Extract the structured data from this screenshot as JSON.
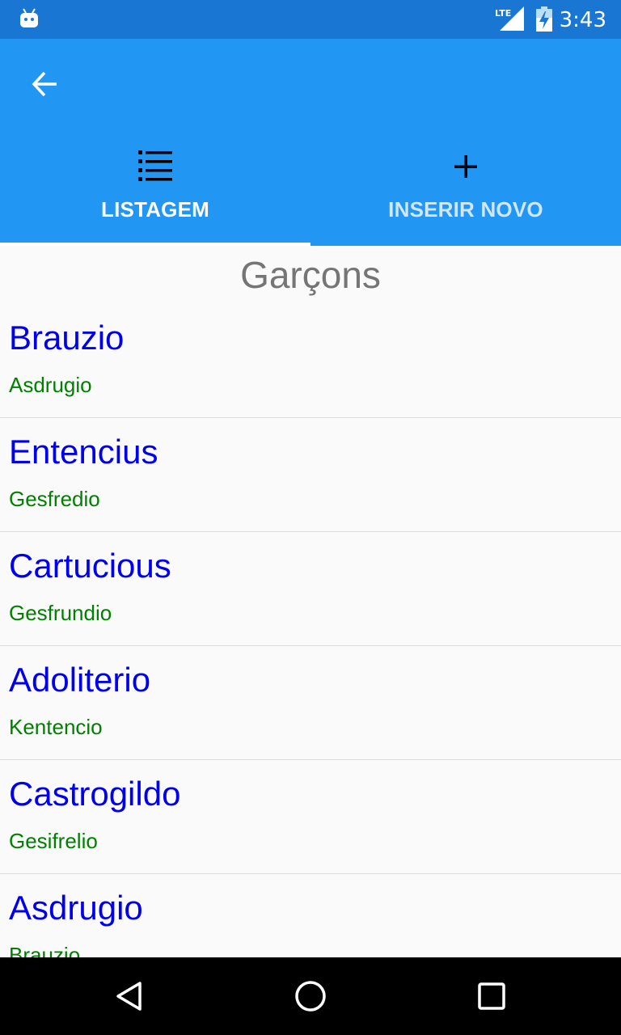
{
  "status_bar": {
    "time": "3:43",
    "network": "LTE",
    "icons": [
      "android-icon",
      "lte-signal-icon",
      "battery-charging-icon"
    ]
  },
  "toolbar": {
    "back_icon": "arrow-back-icon"
  },
  "tabs": [
    {
      "label": "LISTAGEM",
      "icon": "list-icon",
      "selected": true
    },
    {
      "label": "INSERIR NOVO",
      "icon": "plus-icon",
      "selected": false
    }
  ],
  "page": {
    "title": "Garçons"
  },
  "list": [
    {
      "name": "Brauzio",
      "sub": "Asdrugio"
    },
    {
      "name": "Entencius",
      "sub": "Gesfredio"
    },
    {
      "name": "Cartucious",
      "sub": "Gesfrundio"
    },
    {
      "name": "Adoliterio",
      "sub": "Kentencio"
    },
    {
      "name": "Castrogildo",
      "sub": "Gesifrelio"
    },
    {
      "name": "Asdrugio",
      "sub": "Brauzio"
    }
  ],
  "colors": {
    "status_bar": "#1976d2",
    "app_bar": "#2196f3",
    "item_name": "#0000ee",
    "item_sub": "#008000",
    "title": "#757575"
  },
  "navigation_bar": {
    "icons": [
      "back-triangle-icon",
      "home-circle-icon",
      "recents-square-icon"
    ]
  }
}
